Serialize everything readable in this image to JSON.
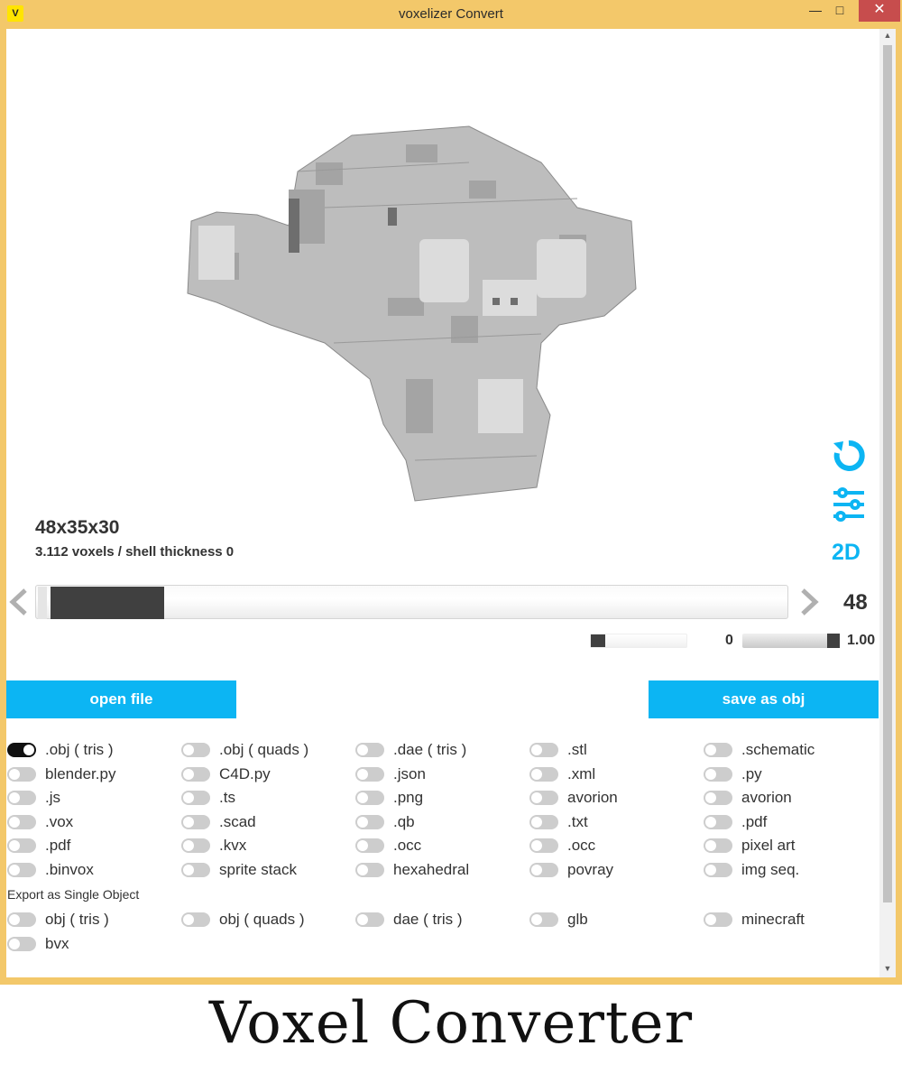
{
  "window": {
    "title": "voxelizer Convert",
    "app_icon": "voxelizer-logo"
  },
  "viewport": {
    "dimensions": "48x35x30",
    "info": "3.112 voxels / shell thickness 0",
    "tools": [
      {
        "icon": "reset-rotate-icon"
      },
      {
        "icon": "settings-sliders-icon"
      },
      {
        "icon": "2d-view-icon",
        "label": "2D"
      }
    ]
  },
  "slider": {
    "value": "48",
    "fill_fraction": 0.17
  },
  "mini_sliders": [
    {
      "value": "0",
      "fill_fraction": 0.0
    },
    {
      "value": "1.00",
      "fill_fraction": 1.0
    }
  ],
  "buttons": {
    "open": "open file",
    "save": "save as obj"
  },
  "formats": [
    [
      ".obj ( tris )",
      ".obj ( quads )",
      ".dae ( tris )",
      ".stl",
      ".schematic"
    ],
    [
      "blender.py",
      "C4D.py",
      ".json",
      ".xml",
      ".py"
    ],
    [
      ".js",
      ".ts",
      ".png",
      "avorion",
      "avorion"
    ],
    [
      ".vox",
      ".scad",
      ".qb",
      ".txt",
      ".pdf"
    ],
    [
      ".pdf",
      ".kvx",
      ".occ",
      ".occ",
      "pixel art"
    ],
    [
      ".binvox",
      "sprite stack",
      "hexahedral",
      "povray",
      "img seq."
    ]
  ],
  "formats_selected": ".obj ( tris )",
  "single_object": {
    "label": "Export as Single Object",
    "items": [
      [
        "obj ( tris )",
        "obj ( quads )",
        "dae ( tris )",
        "glb",
        "minecraft"
      ],
      [
        "bvx"
      ]
    ]
  },
  "caption": "Voxel Converter",
  "colors": {
    "accent": "#0cb5f3",
    "frame": "#f3c86a",
    "close": "#c74d4d",
    "voxel": "#bdbdbd"
  }
}
